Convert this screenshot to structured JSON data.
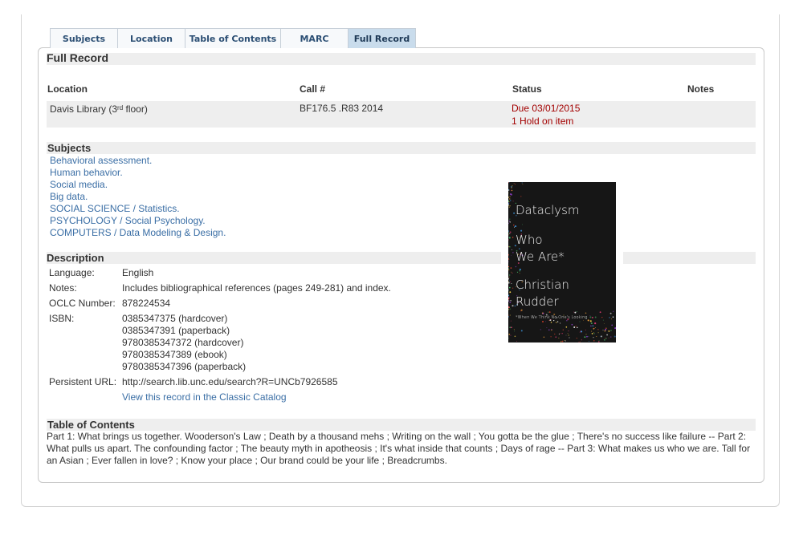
{
  "tabs": [
    {
      "label": "Subjects"
    },
    {
      "label": "Location"
    },
    {
      "label": "Table of Contents"
    },
    {
      "label": "MARC"
    },
    {
      "label": "Full Record"
    }
  ],
  "full_record": {
    "title": "Full Record",
    "headers": {
      "location": "Location",
      "call": "Call #",
      "status": "Status",
      "notes": "Notes"
    },
    "row": {
      "location_prefix": "Davis Library (3",
      "location_sup": "rd",
      "location_suffix": " floor)",
      "call": "BF176.5 .R83 2014",
      "status_due": "Due 03/01/2015",
      "status_hold": "1 Hold on item"
    }
  },
  "subjects": {
    "title": "Subjects",
    "items": [
      "Behavioral assessment.",
      "Human behavior.",
      "Social media.",
      "Big data.",
      "SOCIAL SCIENCE / Statistics.",
      "PSYCHOLOGY / Social Psychology.",
      "COMPUTERS / Data Modeling & Design."
    ]
  },
  "description": {
    "title": "Description",
    "language_label": "Language:",
    "language": "English",
    "notes_label": "Notes:",
    "notes": "Includes bibliographical references (pages 249-281) and index.",
    "oclc_label": "OCLC Number:",
    "oclc": "878224534",
    "isbn_label": "ISBN:",
    "isbns": [
      "0385347375 (hardcover)",
      "0385347391 (paperback)",
      "9780385347372 (hardcover)",
      "9780385347389 (ebook)",
      "9780385347396 (paperback)"
    ],
    "url_label": "Persistent URL:",
    "url": "http://search.lib.unc.edu/search?R=UNCb7926585",
    "classic_link": "View this record in the Classic Catalog"
  },
  "toc": {
    "title": "Table of Contents",
    "text": "Part 1: What brings us together. Wooderson's Law ; Death by a thousand mehs ; Writing on the wall ; You gotta be the glue ; There's no success like failure -- Part 2: What pulls us apart. The confounding factor ; The beauty myth in apotheosis ; It's what inside that counts ; Days of rage -- Part 3: What makes us who we are. Tall for an Asian ; Ever fallen in love? ; Know your place ; Our brand could be your life ; Breadcrumbs."
  },
  "cover": {
    "title": "Dataclysm",
    "subtitle_1": "Who",
    "subtitle_2": "We Are*",
    "author_1": "Christian",
    "author_2": "Rudder",
    "tagline": "*When We Think No One's Looking"
  }
}
